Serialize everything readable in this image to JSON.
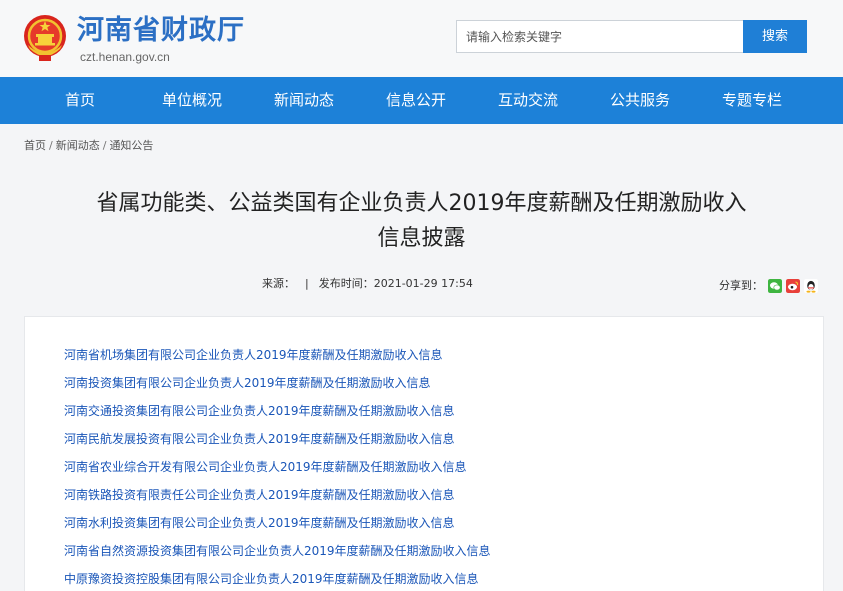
{
  "header": {
    "site_title": "河南省财政厅",
    "site_domain": "czt.henan.gov.cn",
    "emblem_icon": "national-emblem-icon",
    "search_placeholder": "请输入检索关键字",
    "search_button": "搜索"
  },
  "nav": {
    "items": [
      "首页",
      "单位概况",
      "新闻动态",
      "信息公开",
      "互动交流",
      "公共服务",
      "专题专栏"
    ],
    "background": "#1d81d8"
  },
  "breadcrumb": [
    "首页",
    "新闻动态",
    "通知公告"
  ],
  "article": {
    "title_line1": "省属功能类、公益类国有企业负责人2019年度薪酬及任期激励收入",
    "title_line2": "信息披露",
    "source_label": "来源：",
    "publish_time": "发布时间：2021-01-29 17:54",
    "share_label": "分享到：",
    "share_icons": [
      "wechat-icon",
      "weibo-icon",
      "qq-icon"
    ]
  },
  "links": [
    "河南省机场集团有限公司企业负责人2019年度薪酬及任期激励收入信息",
    "河南投资集团有限公司企业负责人2019年度薪酬及任期激励收入信息",
    "河南交通投资集团有限公司企业负责人2019年度薪酬及任期激励收入信息",
    "河南民航发展投资有限公司企业负责人2019年度薪酬及任期激励收入信息",
    "河南省农业综合开发有限公司企业负责人2019年度薪酬及任期激励收入信息",
    "河南铁路投资有限责任公司企业负责人2019年度薪酬及任期激励收入信息",
    "河南水利投资集团有限公司企业负责人2019年度薪酬及任期激励收入信息",
    "河南省自然资源投资集团有限公司企业负责人2019年度薪酬及任期激励收入信息",
    "中原豫资投资控股集团有限公司企业负责人2019年度薪酬及任期激励收入信息"
  ]
}
